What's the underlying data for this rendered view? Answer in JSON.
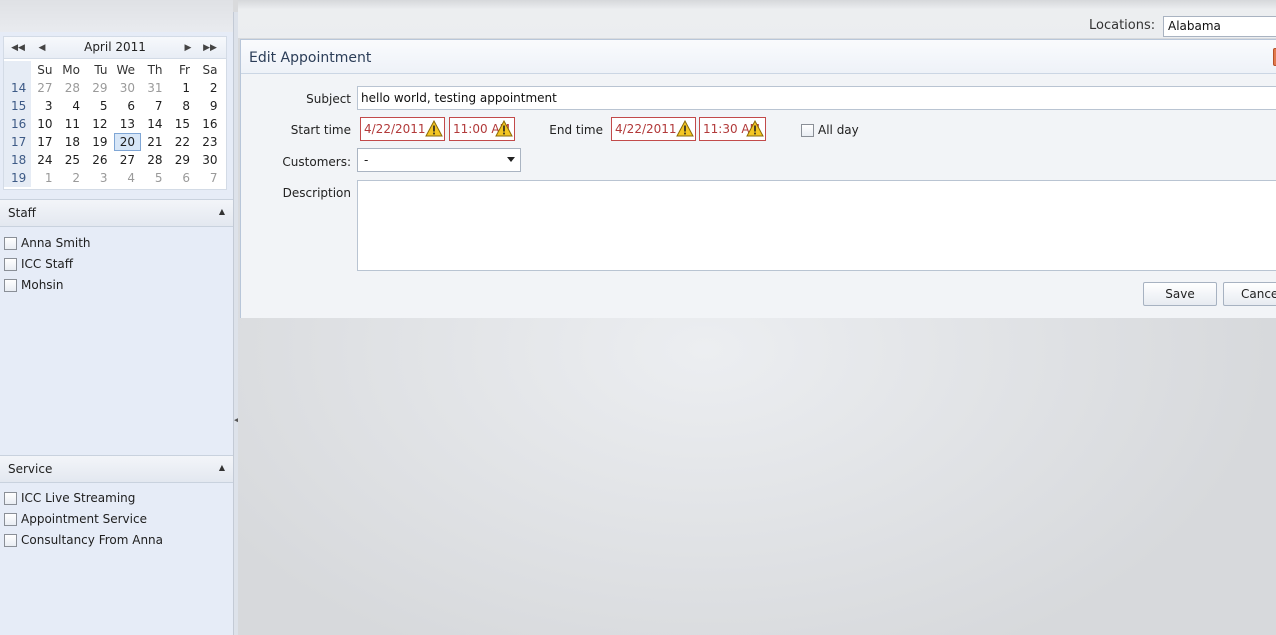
{
  "calendar": {
    "title": "April 2011",
    "nav": {
      "prev_year": "◀◀",
      "prev_month": "◀",
      "next_month": "▶",
      "next_year": "▶▶"
    },
    "weekdays": [
      "Su",
      "Mo",
      "Tu",
      "We",
      "Th",
      "Fr",
      "Sa"
    ],
    "weeks": [
      {
        "num": "14",
        "days": [
          "27",
          "28",
          "29",
          "30",
          "31",
          "1",
          "2"
        ]
      },
      {
        "num": "15",
        "days": [
          "3",
          "4",
          "5",
          "6",
          "7",
          "8",
          "9"
        ]
      },
      {
        "num": "16",
        "days": [
          "10",
          "11",
          "12",
          "13",
          "14",
          "15",
          "16"
        ]
      },
      {
        "num": "17",
        "days": [
          "17",
          "18",
          "19",
          "20",
          "21",
          "22",
          "23"
        ]
      },
      {
        "num": "18",
        "days": [
          "24",
          "25",
          "26",
          "27",
          "28",
          "29",
          "30"
        ]
      },
      {
        "num": "19",
        "days": [
          "1",
          "2",
          "3",
          "4",
          "5",
          "6",
          "7"
        ]
      }
    ],
    "selected_day": "20"
  },
  "staff": {
    "title": "Staff",
    "items": [
      "Anna Smith",
      "ICC Staff",
      "Mohsin"
    ]
  },
  "service": {
    "title": "Service",
    "items": [
      "ICC Live Streaming",
      "Appointment Service",
      "Consultancy From Anna"
    ]
  },
  "topbar": {
    "locations_label": "Locations:",
    "locations_value": "Alabama"
  },
  "dialog": {
    "title": "Edit Appointment",
    "subject_label": "Subject",
    "subject_value": "hello world, testing appointment",
    "start_label": "Start time",
    "start_date": "4/22/2011",
    "start_time": "11:00 AM",
    "end_label": "End time",
    "end_date": "4/22/2011",
    "end_time": "11:30 AM",
    "allday_label": "All day",
    "customers_label": "Customers:",
    "customers_value": "-",
    "description_label": "Description",
    "save_label": "Save",
    "cancel_label": "Cancel"
  },
  "colors": {
    "accent": "#2c3e58",
    "error_border": "#c24a4a",
    "sidebar_bg": "#e6ecf7"
  }
}
